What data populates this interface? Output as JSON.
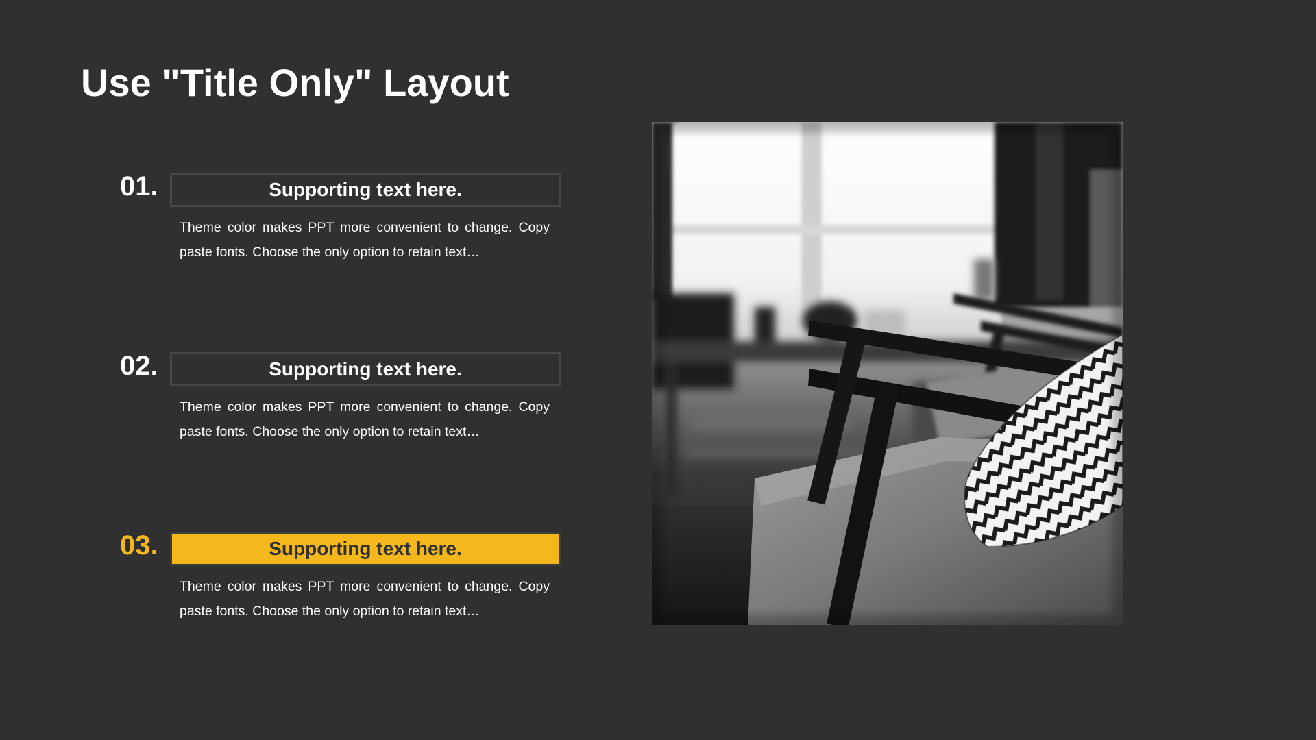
{
  "slide": {
    "title": "Use \"Title Only\" Layout",
    "accent_color": "#F5B81C",
    "background_color": "#303030",
    "items": [
      {
        "number": "01.",
        "heading": "Supporting text here.",
        "body": "Theme color makes PPT more convenient to change. Copy paste fonts. Choose the only option to retain text…",
        "highlighted": false
      },
      {
        "number": "02.",
        "heading": "Supporting text here.",
        "body": "Theme color makes PPT more convenient to change. Copy paste fonts. Choose the only option to retain text…",
        "highlighted": false
      },
      {
        "number": "03.",
        "heading": "Supporting text here.",
        "body": "Theme color makes PPT more convenient to change. Copy paste fonts. Choose the only option to retain text…",
        "highlighted": true
      }
    ],
    "photo": {
      "icon": "armchair-photo"
    }
  }
}
